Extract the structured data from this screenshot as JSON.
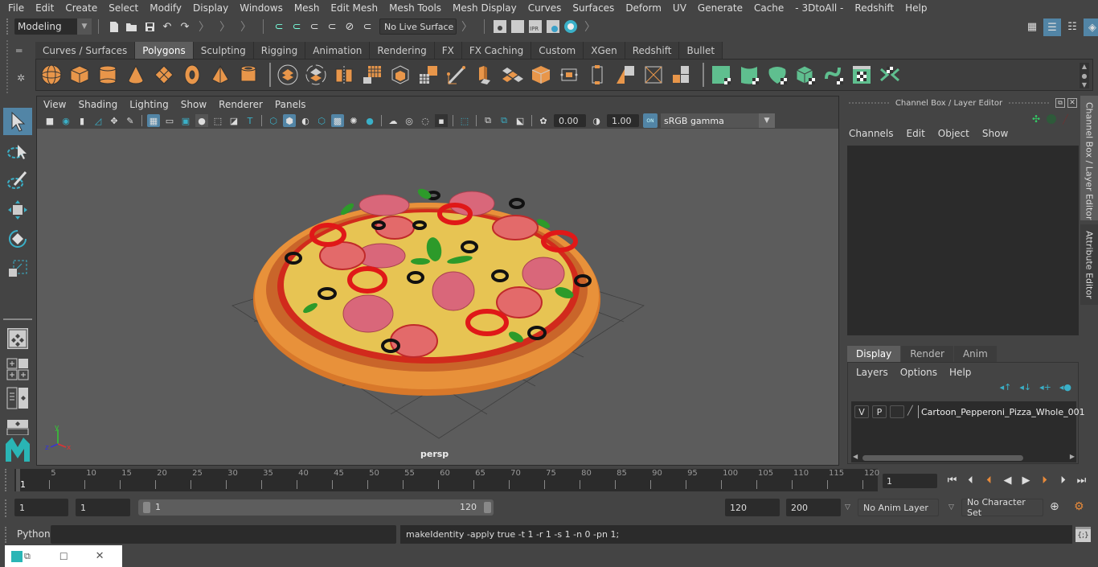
{
  "menubar": {
    "items": [
      "File",
      "Edit",
      "Create",
      "Select",
      "Modify",
      "Display",
      "Windows",
      "Mesh",
      "Edit Mesh",
      "Mesh Tools",
      "Mesh Display",
      "Curves",
      "Surfaces",
      "Deform",
      "UV",
      "Generate",
      "Cache",
      "- 3DtoAll -",
      "Redshift",
      "Help"
    ]
  },
  "statusline": {
    "mode": "Modeling",
    "live_surface": "No Live Surface"
  },
  "shelf": {
    "tabs": [
      "Curves / Surfaces",
      "Polygons",
      "Sculpting",
      "Rigging",
      "Animation",
      "Rendering",
      "FX",
      "FX Caching",
      "Custom",
      "XGen",
      "Redshift",
      "Bullet"
    ],
    "active_tab": "Polygons",
    "icons": [
      "poly-sphere",
      "poly-cube",
      "poly-cylinder",
      "poly-cone",
      "poly-plane",
      "poly-torus",
      "poly-pyramid",
      "poly-pipe",
      "combine",
      "separate",
      "mirror",
      "smooth",
      "extract",
      "bridge",
      "booleans",
      "multi-cut",
      "extrude",
      "bevel",
      "fill-hole",
      "make-live",
      "append-polygon",
      "insert-edge-loop",
      "bevel-edge",
      "merge",
      "target-weld",
      "uv-planar",
      "uv-cylindrical",
      "uv-spherical",
      "uv-automatic",
      "uv-unfold",
      "uv-editor",
      "uv-layout"
    ]
  },
  "viewport": {
    "menu": [
      "View",
      "Shading",
      "Lighting",
      "Show",
      "Renderer",
      "Panels"
    ],
    "exposure": "0.00",
    "gamma": "1.00",
    "color_management": "ON",
    "color_space": "sRGB gamma",
    "camera": "persp",
    "axis": {
      "x": "x",
      "y": "y",
      "z": "z"
    }
  },
  "channelbox": {
    "title": "Channel Box / Layer Editor",
    "menu": [
      "Channels",
      "Edit",
      "Object",
      "Show"
    ]
  },
  "layer_editor": {
    "tabs": [
      "Display",
      "Render",
      "Anim"
    ],
    "active_tab": "Display",
    "menu": [
      "Layers",
      "Options",
      "Help"
    ],
    "layers": [
      {
        "visible": "V",
        "playback": "P",
        "name": "Cartoon_Pepperoni_Pizza_Whole_001"
      }
    ]
  },
  "side_tabs": [
    "Channel Box / Layer Editor",
    "Attribute Editor"
  ],
  "timeline": {
    "ticks": [
      5,
      10,
      15,
      20,
      25,
      30,
      35,
      40,
      45,
      50,
      55,
      60,
      65,
      70,
      75,
      80,
      85,
      90,
      95,
      100,
      105,
      110,
      115,
      120
    ],
    "min": 1,
    "max": 120,
    "current_frame": "1",
    "current_frame_field": "1"
  },
  "range": {
    "start_field": "1",
    "playback_start": "1",
    "slider_start": "1",
    "slider_end": "120",
    "playback_end": "120",
    "end_field": "200",
    "anim_layer": "No Anim Layer",
    "character_set": "No Character Set"
  },
  "commandline": {
    "language": "Python",
    "input": "",
    "result": "makeIdentity -apply true -t 1 -r 1 -s 1 -n 0 -pn 1;"
  },
  "colors": {
    "accent_blue": "#5285a6",
    "shelf_orange": "#e8964a",
    "shelf_green": "#5fbf8f",
    "viewport_bg": "#5c5c5c"
  }
}
